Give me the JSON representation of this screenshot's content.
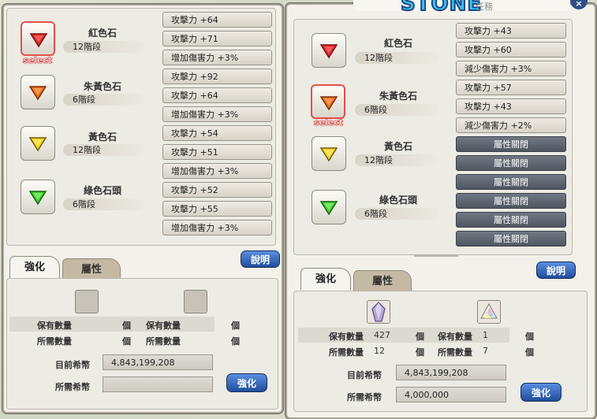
{
  "left": {
    "gems": [
      {
        "name": "紅色石",
        "tier": "12階段",
        "color": "red",
        "selected": true
      },
      {
        "name": "朱黃色石",
        "tier": "6階段",
        "color": "orange",
        "selected": false
      },
      {
        "name": "黃色石",
        "tier": "12階段",
        "color": "yellow",
        "selected": false
      },
      {
        "name": "綠色石頭",
        "tier": "6階段",
        "color": "green",
        "selected": false
      }
    ],
    "select_tag": "select",
    "stats": [
      "攻擊力 +64",
      "攻擊力 +71",
      "增加傷害力 +3%",
      "攻擊力 +92",
      "攻擊力 +64",
      "增加傷害力 +3%",
      "攻擊力 +54",
      "攻擊力 +51",
      "增加傷害力 +3%",
      "攻擊力 +52",
      "攻擊力 +55",
      "增加傷害力 +3%"
    ],
    "help_label": "說明",
    "tabs": [
      "強化",
      "屬性"
    ],
    "owned_label": "保有數量",
    "need_label": "所需數量",
    "unit": "個",
    "current_gold_label": "目前希幣",
    "current_gold": "4,843,199,208",
    "need_gold_label": "所需希幣",
    "need_gold": "",
    "enhance_label": "強化"
  },
  "right": {
    "title": "STONE",
    "title_sub": "任務",
    "close": "×",
    "gems": [
      {
        "name": "紅色石",
        "tier": "12階段",
        "color": "red",
        "selected": false
      },
      {
        "name": "朱黃色石",
        "tier": "6階段",
        "color": "orange",
        "selected": true
      },
      {
        "name": "黃色石",
        "tier": "12階段",
        "color": "yellow",
        "selected": false
      },
      {
        "name": "綠色石頭",
        "tier": "6階段",
        "color": "green",
        "selected": false
      }
    ],
    "select_tag": "select",
    "stats": [
      "攻擊力 +43",
      "攻擊力 +60",
      "減少傷害力 +3%",
      "攻擊力 +57",
      "攻擊力 +43",
      "減少傷害力 +2%",
      "屬性關閉",
      "屬性關閉",
      "屬性關閉",
      "屬性關閉",
      "屬性關閉",
      "屬性關閉"
    ],
    "help_label": "說明",
    "tabs": [
      "強化",
      "屬性"
    ],
    "owned_label": "保有數量",
    "need_label": "所需數量",
    "unit": "個",
    "mat1_owned": "427",
    "mat1_need": "12",
    "mat2_owned": "1",
    "mat2_need": "7",
    "current_gold_label": "目前希幣",
    "current_gold": "4,843,199,208",
    "need_gold_label": "所需希幣",
    "need_gold": "4,000,000",
    "enhance_label": "強化"
  },
  "colors": {
    "red": "#e0292b",
    "orange": "#f06a1c",
    "yellow": "#f2d21c",
    "green": "#3fcf2c",
    "accent": "#2b5db5"
  }
}
